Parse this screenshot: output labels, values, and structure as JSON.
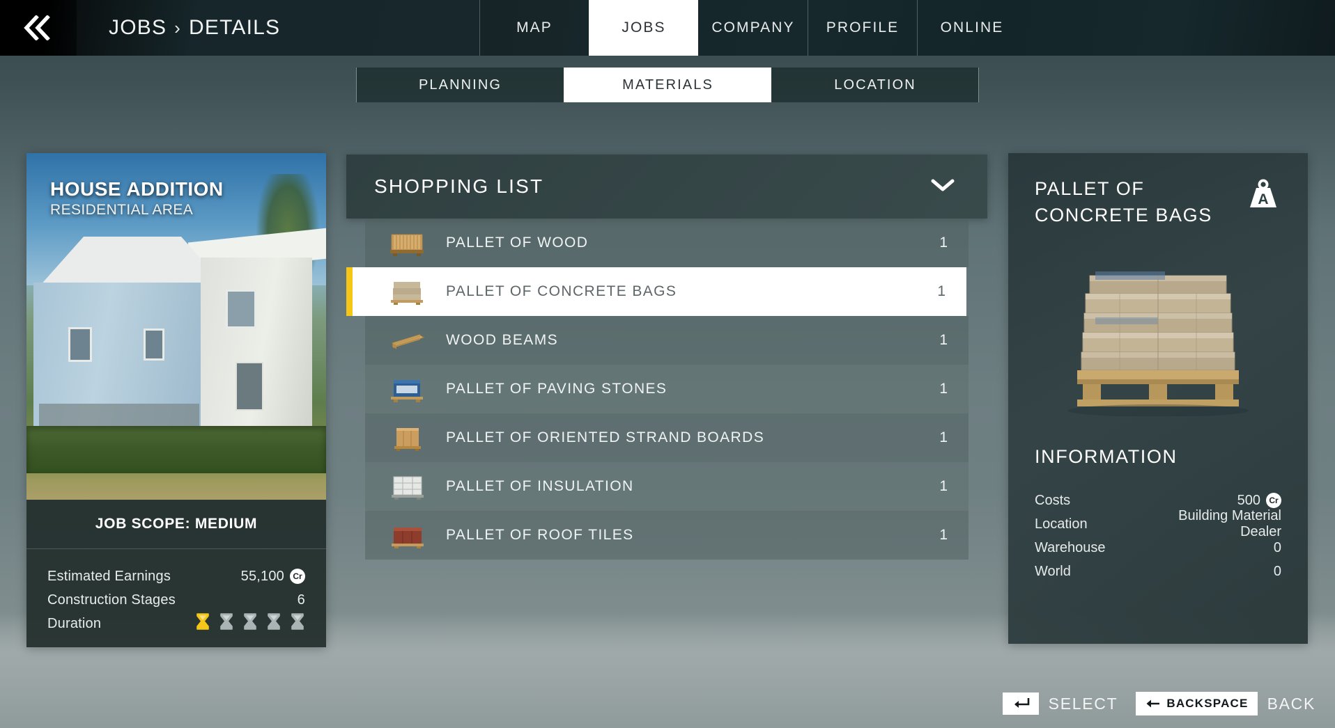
{
  "header": {
    "back_icon": "double-chevron-left-icon",
    "breadcrumb": {
      "root": "JOBS",
      "separator": "›",
      "current": "DETAILS"
    },
    "nav_tabs": [
      {
        "label": "MAP",
        "active": false
      },
      {
        "label": "JOBS",
        "active": true
      },
      {
        "label": "COMPANY",
        "active": false
      },
      {
        "label": "PROFILE",
        "active": false
      },
      {
        "label": "ONLINE",
        "active": false
      }
    ]
  },
  "sub_tabs": [
    {
      "label": "PLANNING",
      "active": false
    },
    {
      "label": "MATERIALS",
      "active": true
    },
    {
      "label": "LOCATION",
      "active": false
    }
  ],
  "job_card": {
    "title": "HOUSE ADDITION",
    "subtitle": "RESIDENTIAL AREA",
    "scope": "JOB SCOPE: MEDIUM",
    "stats": [
      {
        "label": "Estimated Earnings",
        "value": "55,100",
        "currency": "Cr"
      },
      {
        "label": "Construction Stages",
        "value": "6",
        "currency": ""
      },
      {
        "label": "Duration",
        "value": "",
        "currency": ""
      }
    ],
    "duration_total": 5,
    "duration_filled": 1,
    "duration_icon": "hourglass-icon",
    "duration_filled_color": "#f5c518",
    "duration_empty_color": "#aab4b4"
  },
  "shopping_list": {
    "title": "SHOPPING LIST",
    "collapse_icon": "chevron-down-icon",
    "items": [
      {
        "name": "PALLET OF WOOD",
        "qty": "1",
        "icon": "pallet-of-wood-icon",
        "selected": false
      },
      {
        "name": "PALLET OF CONCRETE BAGS",
        "qty": "1",
        "icon": "pallet-of-concrete-bags-icon",
        "selected": true
      },
      {
        "name": "WOOD BEAMS",
        "qty": "1",
        "icon": "wood-beams-icon",
        "selected": false
      },
      {
        "name": "PALLET OF PAVING STONES",
        "qty": "1",
        "icon": "pallet-of-paving-stones-icon",
        "selected": false
      },
      {
        "name": "PALLET OF ORIENTED STRAND BOARDS",
        "qty": "1",
        "icon": "pallet-of-osb-icon",
        "selected": false
      },
      {
        "name": "PALLET OF INSULATION",
        "qty": "1",
        "icon": "pallet-of-insulation-icon",
        "selected": false
      },
      {
        "name": "PALLET OF ROOF TILES",
        "qty": "1",
        "icon": "pallet-of-roof-tiles-icon",
        "selected": false
      }
    ],
    "selected_accent_color": "#f5c518"
  },
  "info_panel": {
    "title": "PALLET OF CONCRETE BAGS",
    "weight_badge": {
      "icon": "weight-class-icon",
      "letter": "A"
    },
    "preview_icon": "pallet-of-concrete-bags-preview",
    "section_title": "INFORMATION",
    "rows": [
      {
        "label": "Costs",
        "value": "500",
        "currency": "Cr"
      },
      {
        "label": "Location",
        "value": "Building Material Dealer",
        "currency": ""
      },
      {
        "label": "Warehouse",
        "value": "0",
        "currency": ""
      },
      {
        "label": "World",
        "value": "0",
        "currency": ""
      }
    ]
  },
  "action_bar": {
    "select": {
      "key": "↵",
      "label": "SELECT",
      "key_icon": "enter-key-icon"
    },
    "back": {
      "key": "BACKSPACE",
      "key_icon": "arrow-left-icon",
      "label": "BACK"
    }
  }
}
